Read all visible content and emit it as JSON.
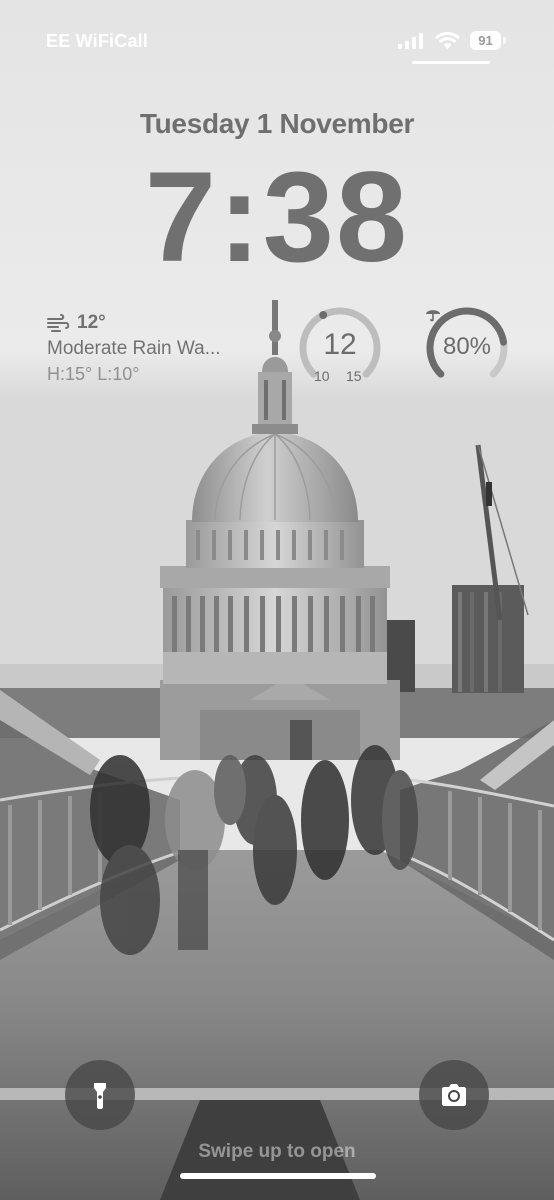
{
  "status_bar": {
    "carrier": "EE WiFiCall",
    "battery_level": "91",
    "icons": [
      "signal-icon",
      "wifi-icon",
      "battery-icon"
    ]
  },
  "lock_screen": {
    "date": "Tuesday 1 November",
    "time": "7:38"
  },
  "widgets": {
    "weather": {
      "icon": "wind-icon",
      "temperature": "12°",
      "condition": "Moderate Rain Wa...",
      "high_low": "H:15° L:10°"
    },
    "temperature_gauge": {
      "current": "12",
      "low": "10",
      "high": "15",
      "position": 0.4
    },
    "rain_gauge": {
      "value": "80%",
      "fraction": 0.8,
      "icon": "umbrella-icon"
    }
  },
  "controls": {
    "flashlight_icon": "flashlight-icon",
    "camera_icon": "camera-icon"
  },
  "swipe_hint": "Swipe up to open",
  "colors": {
    "text_primary": "#707070",
    "widget_track": "#c8c8c8",
    "button_bg": "#464646"
  }
}
